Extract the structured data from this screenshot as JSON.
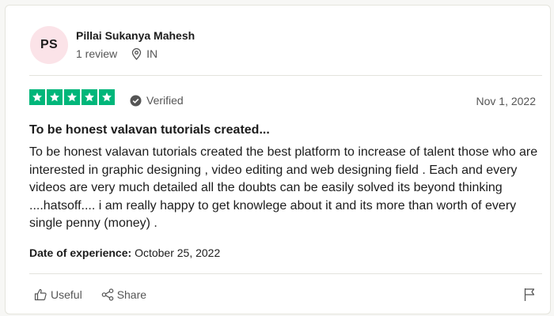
{
  "reviewer": {
    "initials": "PS",
    "name": "Pillai Sukanya Mahesh",
    "review_count": "1 review",
    "location": "IN",
    "avatar_color": "#fbe3e8"
  },
  "review": {
    "rating": 5,
    "star_color": "#00b67a",
    "verified_label": "Verified",
    "date": "Nov 1, 2022",
    "title": "To be honest valavan tutorials created...",
    "body": "To be honest valavan tutorials created the best platform to increase of talent those who are interested in graphic designing , video editing and web designing field . Each and every videos are very much detailed all the doubts can be easily solved its beyond thinking ....hatsoff.... i am really happy to get knowlege about it and its more than worth of every single penny (money) .",
    "experience_label": "Date of experience:",
    "experience_date": "October 25, 2022"
  },
  "actions": {
    "useful_label": "Useful",
    "share_label": "Share"
  },
  "icons": {
    "location": "location-pin-icon",
    "verified": "verified-check-icon",
    "useful": "thumbs-up-icon",
    "share": "share-icon",
    "report": "flag-icon"
  }
}
